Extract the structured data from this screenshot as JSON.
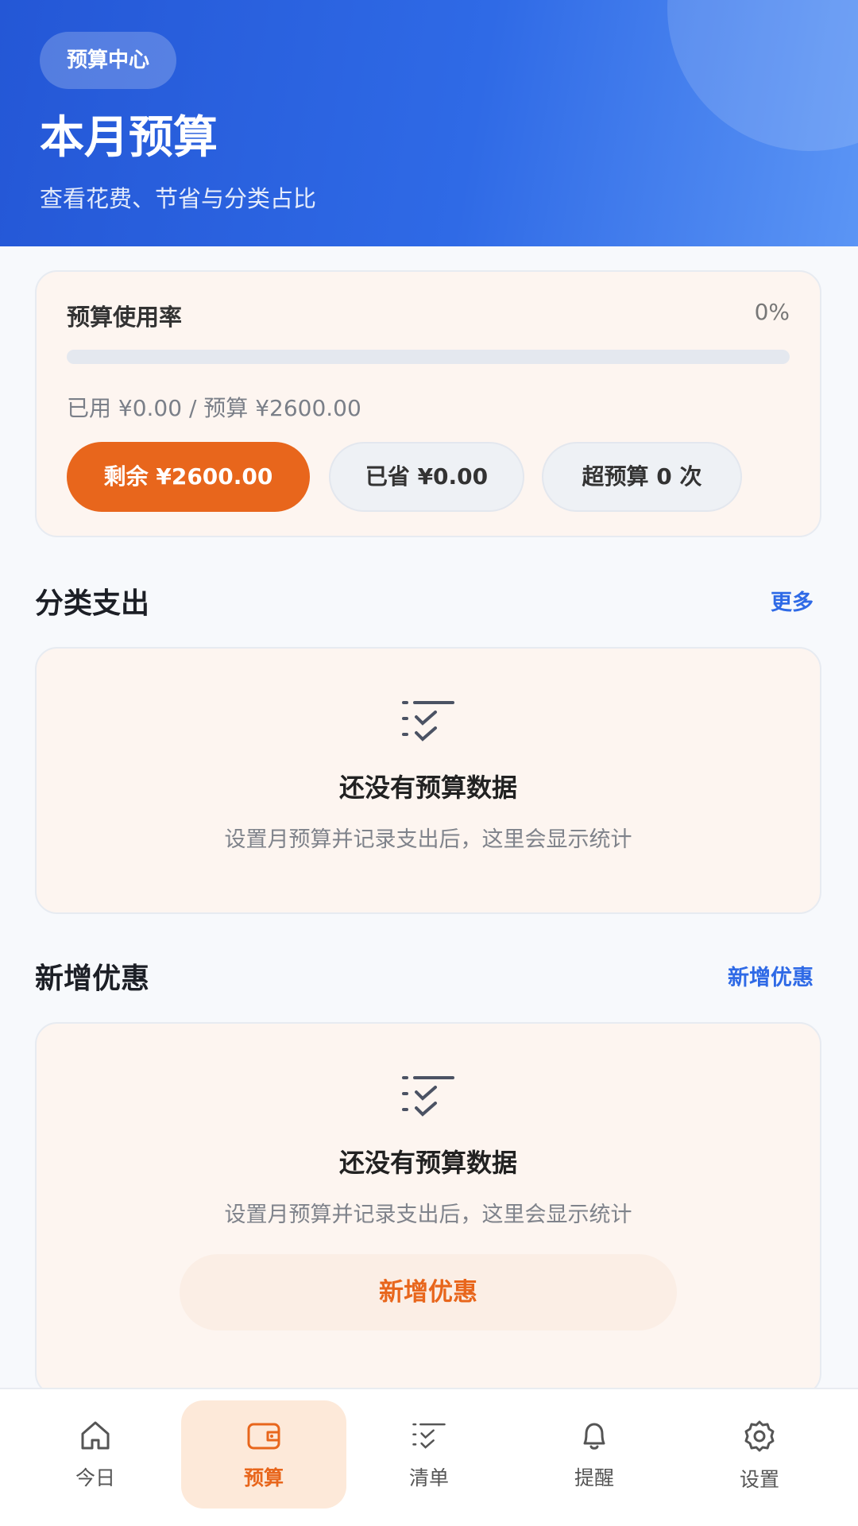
{
  "header": {
    "badge": "预算中心",
    "title": "本月预算",
    "subtitle": "查看花费、节省与分类占比"
  },
  "usage": {
    "label": "预算使用率",
    "percent_text": "0%",
    "progress_fraction": 0,
    "summary": "已用 ¥0.00 / 预算 ¥2600.00",
    "remaining_label": "剩余 ¥2600.00",
    "saved_label": "已省 ¥0.00",
    "over_budget_label": "超预算 0 次"
  },
  "category_section": {
    "title": "分类支出",
    "link": "更多",
    "empty_title": "还没有预算数据",
    "empty_desc": "设置月预算并记录支出后，这里会显示统计"
  },
  "discount_section": {
    "title": "新增优惠",
    "link": "新增优惠",
    "empty_title": "还没有预算数据",
    "empty_desc": "设置月预算并记录支出后，这里会显示统计",
    "action_label": "新增优惠"
  },
  "tabbar": {
    "items": [
      {
        "label": "今日",
        "icon": "home-icon"
      },
      {
        "label": "预算",
        "icon": "wallet-icon",
        "active": true
      },
      {
        "label": "清单",
        "icon": "checklist-icon"
      },
      {
        "label": "提醒",
        "icon": "bell-icon"
      },
      {
        "label": "设置",
        "icon": "gear-icon"
      }
    ]
  },
  "colors": {
    "accent": "#e8661c",
    "primary": "#2f6ae6",
    "header_gradient_start": "#2457d6",
    "header_gradient_end": "#5b95f5"
  }
}
